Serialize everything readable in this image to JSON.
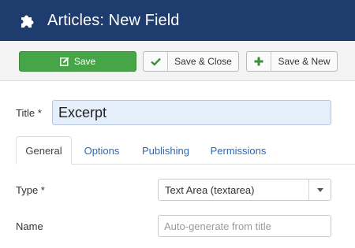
{
  "header": {
    "title": "Articles: New Field",
    "icon": "puzzle-icon",
    "background": "#1e3d6e"
  },
  "toolbar": {
    "save_label": "Save",
    "save_close_label": "Save & Close",
    "save_new_label": "Save & New",
    "save_color": "#46a546"
  },
  "form": {
    "title_label": "Title *",
    "title_value": "Excerpt",
    "tabs": [
      {
        "label": "General",
        "active": true
      },
      {
        "label": "Options",
        "active": false
      },
      {
        "label": "Publishing",
        "active": false
      },
      {
        "label": "Permissions",
        "active": false
      }
    ],
    "type_label": "Type *",
    "type_value": "Text Area (textarea)",
    "name_label": "Name",
    "name_placeholder": "Auto-generate from title"
  }
}
